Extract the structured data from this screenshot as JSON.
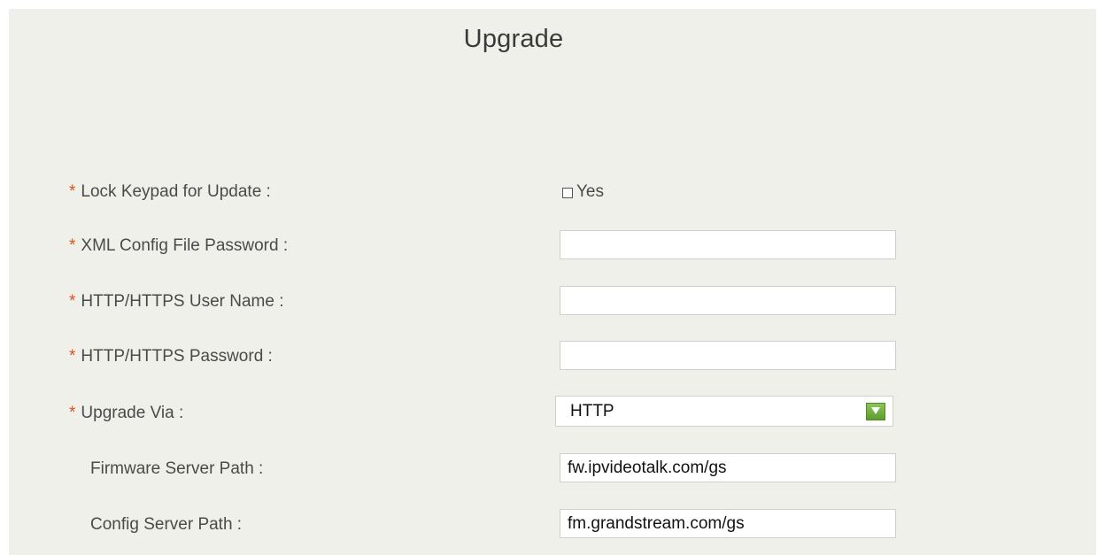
{
  "page": {
    "title": "Upgrade"
  },
  "form": {
    "required_marker": "*",
    "lock_keypad": {
      "label": "Lock Keypad for Update :",
      "checkbox_label": "Yes",
      "checked": false
    },
    "xml_config_password": {
      "label": "XML Config File Password :",
      "value": ""
    },
    "http_user_name": {
      "label": "HTTP/HTTPS User Name :",
      "value": ""
    },
    "http_password": {
      "label": "HTTP/HTTPS Password :",
      "value": ""
    },
    "upgrade_via": {
      "label": "Upgrade Via :",
      "value": "HTTP",
      "icon": "chevron-down-icon",
      "icon_color": "#6aaa38"
    },
    "firmware_server_path": {
      "label": "Firmware Server Path :",
      "value": "fw.ipvideotalk.com/gs"
    },
    "config_server_path": {
      "label": "Config Server Path :",
      "value": "fm.grandstream.com/gs"
    }
  },
  "colors": {
    "panel_background": "#f0f0ea",
    "required_marker": "#d9531e",
    "label_text": "#4a4a4a"
  }
}
